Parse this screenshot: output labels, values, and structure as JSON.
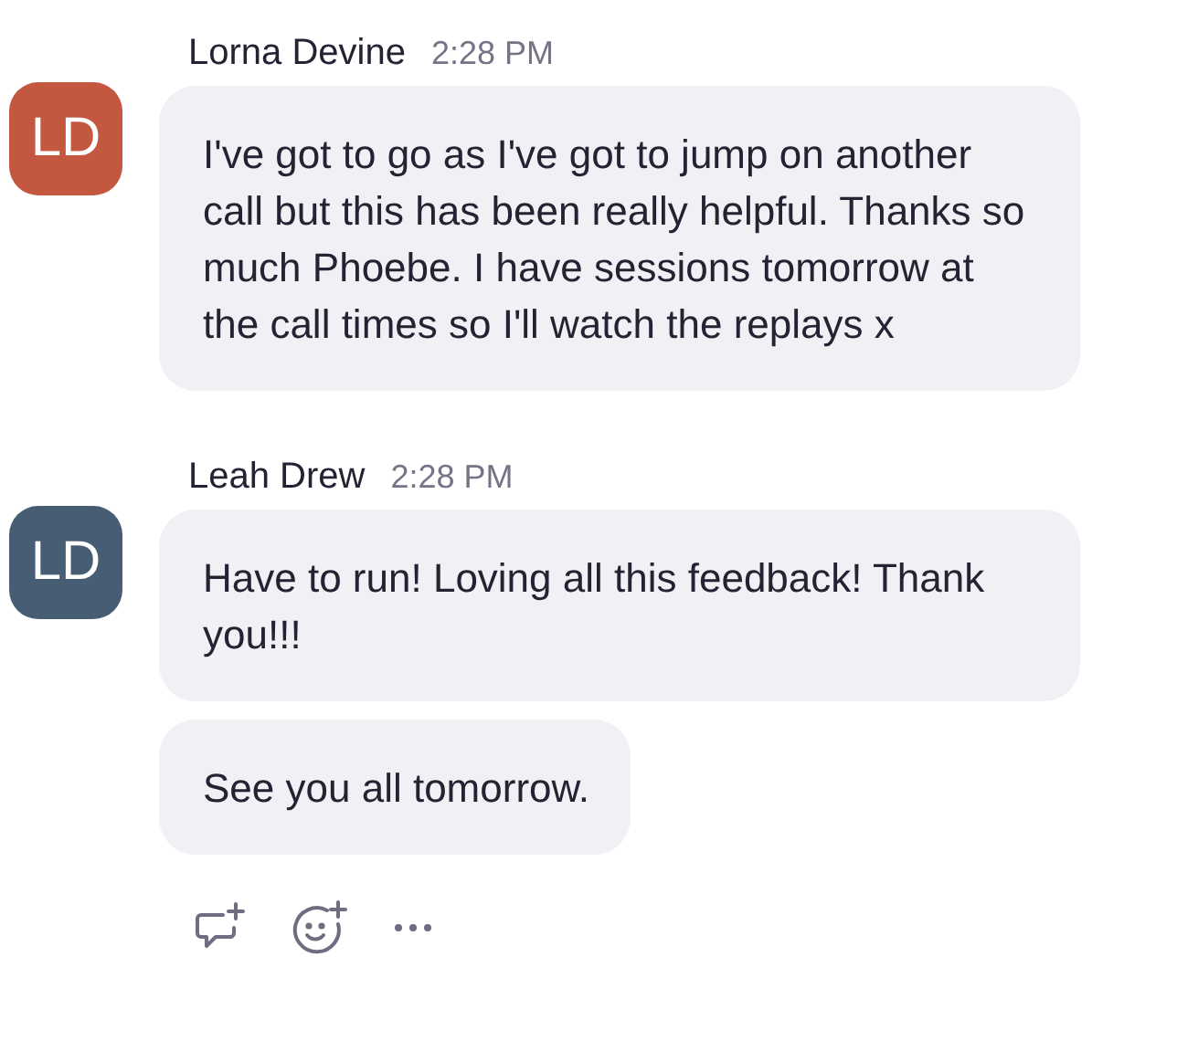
{
  "messages": [
    {
      "sender": "Lorna Devine",
      "time": "2:28 PM",
      "initials": "LD",
      "color": "#c4573f",
      "bubbles": [
        "I've got to go as I've got to jump on another call but this has been really helpful. Thanks so much Phoebe. I have sessions tomorrow at the call times so I'll watch the replays x"
      ]
    },
    {
      "sender": "Leah Drew",
      "time": "2:28 PM",
      "initials": "LD",
      "color": "#475d74",
      "bubbles": [
        "Have to run! Loving all this feedback! Thank you!!!",
        "See you all tomorrow."
      ]
    }
  ]
}
